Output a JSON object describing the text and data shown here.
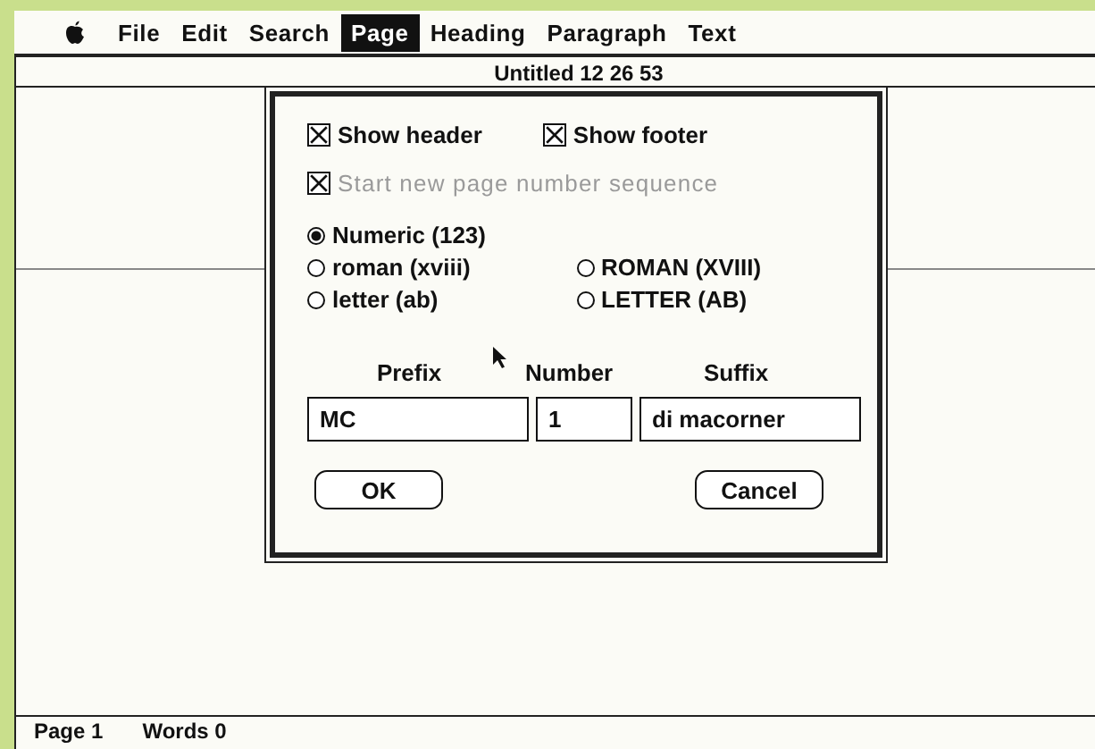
{
  "menu_bar": {
    "items": [
      {
        "label": "File",
        "selected": false
      },
      {
        "label": "Edit",
        "selected": false
      },
      {
        "label": "Search",
        "selected": false
      },
      {
        "label": "Page",
        "selected": true
      },
      {
        "label": "Heading",
        "selected": false
      },
      {
        "label": "Paragraph",
        "selected": false
      },
      {
        "label": "Text",
        "selected": false
      }
    ]
  },
  "window": {
    "title": "Untitled 12 26 53"
  },
  "dialog": {
    "checkbox_rows": [
      {
        "options": [
          {
            "label": "Show header",
            "checked": true,
            "disabled": false
          },
          {
            "label": "Show footer",
            "checked": true,
            "disabled": false
          }
        ]
      },
      {
        "options": [
          {
            "label": "Start new page number sequence",
            "checked": true,
            "disabled": true
          }
        ]
      }
    ],
    "radio_rows": [
      {
        "options": [
          {
            "label": "Numeric (123)",
            "selected": true
          }
        ]
      },
      {
        "options": [
          {
            "label": "roman (xviii)",
            "selected": false
          },
          {
            "label": "ROMAN (XVIII)",
            "selected": false
          }
        ]
      },
      {
        "options": [
          {
            "label": "letter (ab)",
            "selected": false
          },
          {
            "label": "LETTER (AB)",
            "selected": false
          }
        ]
      }
    ],
    "fields": [
      {
        "label": "Prefix",
        "value": "MC"
      },
      {
        "label": "Number",
        "value": "1"
      },
      {
        "label": "Suffix",
        "value": "di macorner"
      }
    ],
    "buttons": [
      {
        "label": "OK"
      },
      {
        "label": "Cancel"
      }
    ]
  },
  "status_bar": {
    "page": "Page 1",
    "words": "Words 0"
  }
}
